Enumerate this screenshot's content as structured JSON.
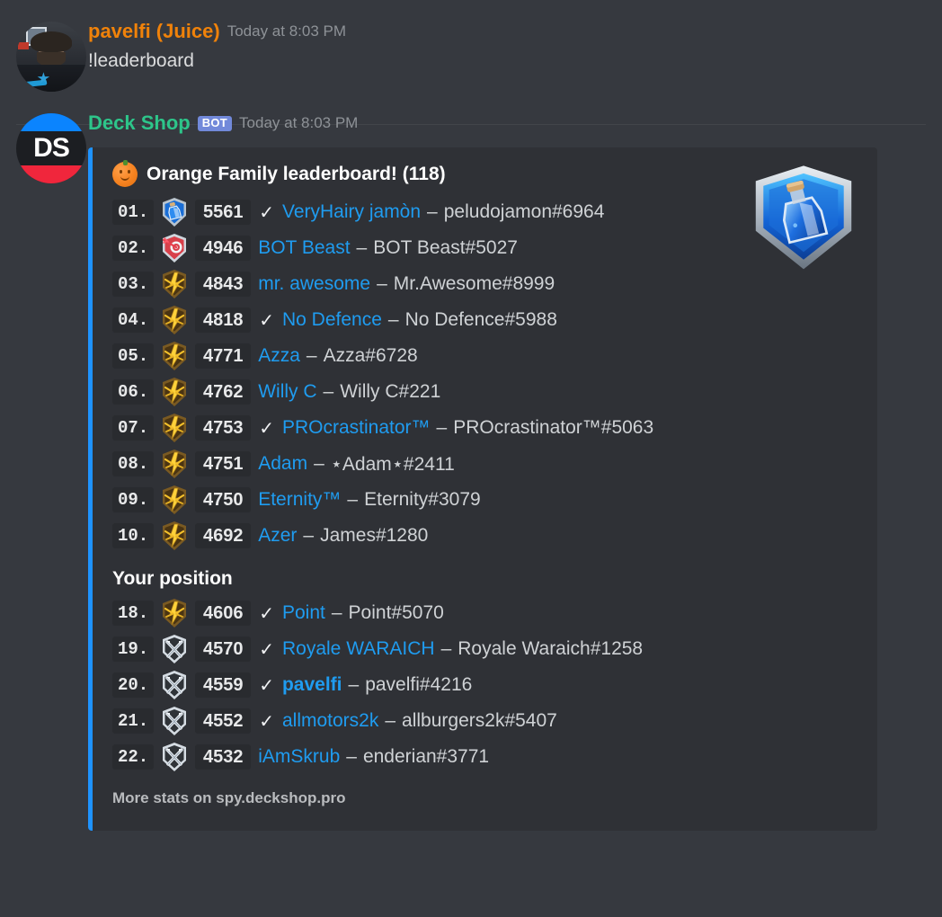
{
  "app": {
    "name": "Discord",
    "theme": "dark"
  },
  "colors": {
    "background": "#36393f",
    "embed_background": "#2f3136",
    "embed_border": "#1e93ff",
    "user_name": "#f0820a",
    "bot_name": "#2dc58a",
    "bot_tag_bg": "#7289da",
    "player_link": "#1f9cf0",
    "muted_text": "#8e9297",
    "body_text": "#dcddde"
  },
  "messages": [
    {
      "author": "pavelfi (Juice)",
      "timestamp": "Today at 8:03 PM",
      "is_bot": false,
      "avatar_name": "pavelfi-avatar",
      "text": "!leaderboard"
    },
    {
      "author": "Deck Shop",
      "bot_tag": "BOT",
      "timestamp": "Today at 8:03 PM",
      "is_bot": true,
      "avatar_name": "deck-shop-avatar",
      "avatar_initials": "DS"
    }
  ],
  "embed": {
    "title_emoji": "orange-emoji",
    "title": "Orange Family leaderboard! (118)",
    "thumbnail_name": "arena-badge-potion-thumbnail",
    "footer": "More stats on spy.deckshop.pro",
    "your_position_label": "Your position",
    "top_entries": [
      {
        "rank": "01.",
        "badge": "arena-potion",
        "score": "5561",
        "verified": true,
        "name": "VeryHairy jamòn",
        "tag": "peludojamon#6964",
        "bold": false
      },
      {
        "rank": "02.",
        "badge": "arena-target",
        "score": "4946",
        "verified": false,
        "name": "BOT Beast",
        "tag": "BOT Beast#5027",
        "bold": false
      },
      {
        "rank": "03.",
        "badge": "arena-gold",
        "score": "4843",
        "verified": false,
        "name": "mr. awesome",
        "tag": "Mr.Awesome#8999",
        "bold": false
      },
      {
        "rank": "04.",
        "badge": "arena-gold",
        "score": "4818",
        "verified": true,
        "name": "No Defence",
        "tag": "No Defence#5988",
        "bold": false
      },
      {
        "rank": "05.",
        "badge": "arena-gold",
        "score": "4771",
        "verified": false,
        "name": "Azza",
        "tag": "Azza#6728",
        "bold": false
      },
      {
        "rank": "06.",
        "badge": "arena-gold",
        "score": "4762",
        "verified": false,
        "name": "Willy C",
        "tag": "Willy C#221",
        "bold": false
      },
      {
        "rank": "07.",
        "badge": "arena-gold",
        "score": "4753",
        "verified": true,
        "name": "PROcrastinator™",
        "tag": "PROcrastinator™#5063",
        "bold": false
      },
      {
        "rank": "08.",
        "badge": "arena-gold",
        "score": "4751",
        "verified": false,
        "name": "Adam",
        "tag": "⋆Adam⋆#2411",
        "bold": false
      },
      {
        "rank": "09.",
        "badge": "arena-gold",
        "score": "4750",
        "verified": false,
        "name": "Eternity™",
        "tag": "Eternity#3079",
        "bold": false
      },
      {
        "rank": "10.",
        "badge": "arena-gold",
        "score": "4692",
        "verified": false,
        "name": "Azer",
        "tag": "James#1280",
        "bold": false
      }
    ],
    "your_position_entries": [
      {
        "rank": "18.",
        "badge": "arena-gold",
        "score": "4606",
        "verified": true,
        "name": "Point",
        "tag": "Point#5070",
        "bold": false
      },
      {
        "rank": "19.",
        "badge": "arena-silver",
        "score": "4570",
        "verified": true,
        "name": "Royale WARAICH",
        "tag": "Royale Waraich#1258",
        "bold": false
      },
      {
        "rank": "20.",
        "badge": "arena-silver",
        "score": "4559",
        "verified": true,
        "name": "pavelfi",
        "tag": "pavelfi#4216",
        "bold": true
      },
      {
        "rank": "21.",
        "badge": "arena-silver",
        "score": "4552",
        "verified": true,
        "name": "allmotors2k",
        "tag": "allburgers2k#5407",
        "bold": false
      },
      {
        "rank": "22.",
        "badge": "arena-silver",
        "score": "4532",
        "verified": false,
        "name": "iAmSkrub",
        "tag": "enderian#3771",
        "bold": false
      }
    ]
  },
  "glyphs": {
    "check": "✓",
    "dash": "–"
  }
}
